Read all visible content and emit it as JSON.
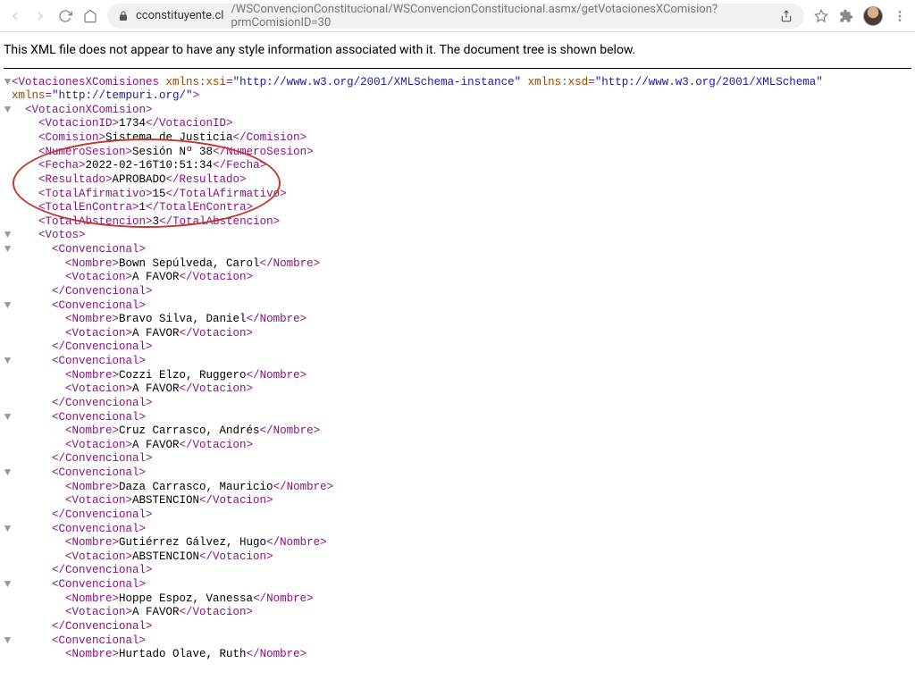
{
  "toolbar": {
    "url_host": "cconstituyente.cl",
    "url_path": "/WSConvencionConstitucional/WSConvencionConstitucional.asmx/getVotacionesXComision?prmComisionID=30"
  },
  "banner": "This XML file does not appear to have any style information associated with it. The document tree is shown below.",
  "xml": {
    "root_tag": "VotacionesXComisiones",
    "root_attrs": [
      {
        "name": "xmlns:xsi",
        "value": "http://www.w3.org/2001/XMLSchema-instance"
      },
      {
        "name": "xmlns:xsd",
        "value": "http://www.w3.org/2001/XMLSchema"
      }
    ],
    "root_attrs_line2": [
      {
        "name": "xmlns",
        "value": "http://tempuri.org/"
      }
    ],
    "child_tag": "VotacionXComision",
    "fields": [
      {
        "tag": "VotacionID",
        "value": "1734"
      },
      {
        "tag": "Comision",
        "value": "Sistema de Justicia"
      },
      {
        "tag": "NumeroSesion",
        "value": "Sesión Nº 38"
      },
      {
        "tag": "Fecha",
        "value": "2022-02-16T10:51:34"
      },
      {
        "tag": "Resultado",
        "value": "APROBADO"
      },
      {
        "tag": "TotalAfirmativo",
        "value": "15"
      },
      {
        "tag": "TotalEnContra",
        "value": "1"
      },
      {
        "tag": "TotalAbstencion",
        "value": "3"
      }
    ],
    "votos_tag": "Votos",
    "convencional_tag": "Convencional",
    "nombre_tag": "Nombre",
    "votacion_tag": "Votacion",
    "convencionales": [
      {
        "nombre": "Bown Sepúlveda, Carol",
        "votacion": "A FAVOR",
        "closed": true
      },
      {
        "nombre": "Bravo Silva, Daniel",
        "votacion": "A FAVOR",
        "closed": true
      },
      {
        "nombre": "Cozzi Elzo, Ruggero",
        "votacion": "A FAVOR",
        "closed": true
      },
      {
        "nombre": "Cruz Carrasco, Andrés",
        "votacion": "A FAVOR",
        "closed": true
      },
      {
        "nombre": "Daza Carrasco, Mauricio",
        "votacion": "ABSTENCION",
        "closed": true
      },
      {
        "nombre": "Gutiérrez Gálvez, Hugo",
        "votacion": "ABSTENCION",
        "closed": true
      },
      {
        "nombre": "Hoppe Espoz, Vanessa",
        "votacion": "A FAVOR",
        "closed": true
      },
      {
        "nombre": "Hurtado Olave, Ruth",
        "votacion": null,
        "closed": false
      }
    ]
  }
}
